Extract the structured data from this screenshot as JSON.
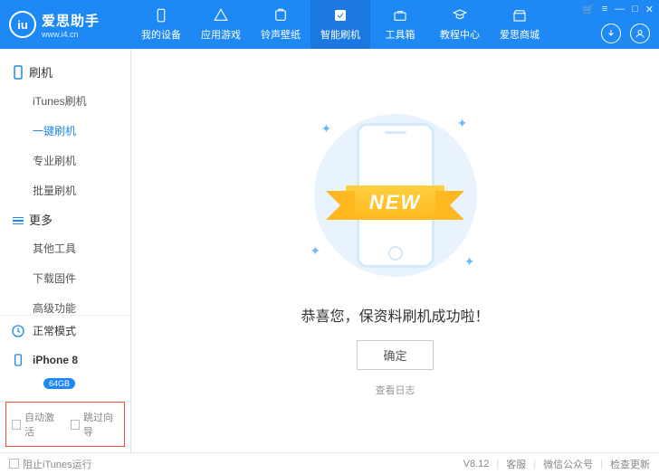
{
  "header": {
    "logo_text": "iu",
    "app_name": "爱思助手",
    "app_url": "www.i4.cn",
    "tabs": [
      {
        "label": "我的设备"
      },
      {
        "label": "应用游戏"
      },
      {
        "label": "铃声壁纸"
      },
      {
        "label": "智能刷机"
      },
      {
        "label": "工具箱"
      },
      {
        "label": "教程中心"
      },
      {
        "label": "爱思商城"
      }
    ]
  },
  "sidebar": {
    "group1": {
      "title": "刷机",
      "items": [
        "iTunes刷机",
        "一键刷机",
        "专业刷机",
        "批量刷机"
      ]
    },
    "group2": {
      "title": "更多",
      "items": [
        "其他工具",
        "下载固件",
        "高级功能"
      ]
    },
    "mode_label": "正常模式",
    "device_name": "iPhone 8",
    "device_storage": "64GB",
    "auto_activate": "自动激活",
    "skip_wizard": "跳过向导"
  },
  "main": {
    "ribbon": "NEW",
    "success_msg": "恭喜您，保资料刷机成功啦！",
    "confirm": "确定",
    "view_log": "查看日志"
  },
  "footer": {
    "block_itunes": "阻止iTunes运行",
    "version": "V8.12",
    "support": "客服",
    "wechat": "微信公众号",
    "check_update": "检查更新"
  }
}
